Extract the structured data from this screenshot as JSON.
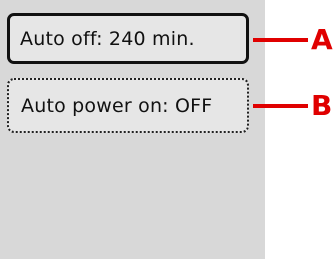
{
  "screen": {
    "menu": [
      {
        "label": "Auto off: 240 min.",
        "selected": true
      },
      {
        "label": "Auto power on: OFF",
        "selected": false
      }
    ]
  },
  "callouts": {
    "a": "A",
    "b": "B",
    "color": "#e00000"
  }
}
